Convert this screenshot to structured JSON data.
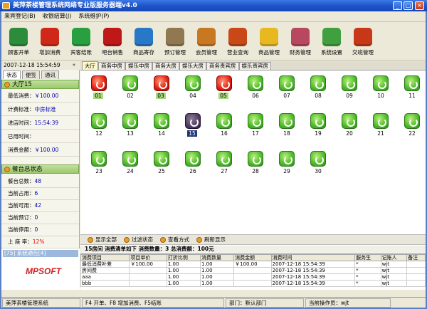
{
  "window": {
    "title": "美萍茶楼管理系统网络专业版服务器端v4.0",
    "min": "_",
    "max": "□",
    "close": "×"
  },
  "menu": [
    "来宾登记(B)",
    "收银结算(J)",
    "系统维护(P)"
  ],
  "toolbar": [
    {
      "label": "顾客开单",
      "icon": "teacup-icon",
      "color": "#2c8c3c"
    },
    {
      "label": "增加消费",
      "icon": "plus-icon",
      "color": "#d02818"
    },
    {
      "label": "宾客结账",
      "icon": "checkout-arrow-icon",
      "color": "#28a040"
    },
    {
      "label": "吧台销售",
      "icon": "wine-icon",
      "color": "#c01818"
    },
    {
      "label": "商品寄存",
      "icon": "basket-icon",
      "color": "#2878c8"
    },
    {
      "label": "预订管理",
      "icon": "clock-icon",
      "color": "#907850"
    },
    {
      "label": "会员管理",
      "icon": "members-icon",
      "color": "#c87820"
    },
    {
      "label": "营业查询",
      "icon": "search-pen-icon",
      "color": "#c84818"
    },
    {
      "label": "商品管理",
      "icon": "star-icon",
      "color": "#e8b820"
    },
    {
      "label": "财务管理",
      "icon": "calculator-icon",
      "color": "#b84860"
    },
    {
      "label": "系统设置",
      "icon": "gears-icon",
      "color": "#40a040"
    },
    {
      "label": "交班管理",
      "icon": "exit-door-icon",
      "color": "#c83818"
    }
  ],
  "left": {
    "datetime": "2007-12-18 15:54:59",
    "collapse": "«",
    "tabs": [
      "状态",
      "便签",
      "通讯"
    ],
    "room_section_title": "大厅15",
    "room_info": [
      {
        "label": "最低消费：",
        "value": "￥100.00"
      },
      {
        "label": "计费标准：",
        "value": "中房标准"
      },
      {
        "label": "进店时间：",
        "value": "15:54:39"
      },
      {
        "label": "已用时间：",
        "value": ""
      },
      {
        "label": "消费金额：",
        "value": "￥100.00"
      }
    ],
    "summary_title": "餐台总状态",
    "summary": [
      {
        "label": "餐台总数：",
        "value": "48"
      },
      {
        "label": "当前占用：",
        "value": "6"
      },
      {
        "label": "当前可用：",
        "value": "42"
      },
      {
        "label": "当前预订：",
        "value": "0"
      },
      {
        "label": "当前停用：",
        "value": "0"
      },
      {
        "label": "上 座 率：",
        "value": "12%"
      }
    ],
    "sys_notice": "[75] 系统通告[4]",
    "logo_text": "MPSOFT"
  },
  "area_tabs": [
    "大厅",
    "商务中房",
    "娱乐中房",
    "商务大房",
    "娱乐大房",
    "商务贵宾房",
    "娱乐贵宾房"
  ],
  "rooms": [
    {
      "num": "01",
      "state": "occupied"
    },
    {
      "num": "02",
      "state": "free"
    },
    {
      "num": "03",
      "state": "occupied"
    },
    {
      "num": "04",
      "state": "free"
    },
    {
      "num": "05",
      "state": "occupied"
    },
    {
      "num": "06",
      "state": "free"
    },
    {
      "num": "07",
      "state": "free"
    },
    {
      "num": "08",
      "state": "free"
    },
    {
      "num": "09",
      "state": "free"
    },
    {
      "num": "10",
      "state": "free"
    },
    {
      "num": "11",
      "state": "free"
    },
    {
      "num": "12",
      "state": "free"
    },
    {
      "num": "13",
      "state": "free"
    },
    {
      "num": "14",
      "state": "free"
    },
    {
      "num": "15",
      "state": "selected"
    },
    {
      "num": "16",
      "state": "free"
    },
    {
      "num": "17",
      "state": "free"
    },
    {
      "num": "18",
      "state": "free"
    },
    {
      "num": "19",
      "state": "free"
    },
    {
      "num": "20",
      "state": "free"
    },
    {
      "num": "21",
      "state": "free"
    },
    {
      "num": "22",
      "state": "free"
    },
    {
      "num": "23",
      "state": "free"
    },
    {
      "num": "24",
      "state": "free"
    },
    {
      "num": "25",
      "state": "free"
    },
    {
      "num": "26",
      "state": "free"
    },
    {
      "num": "27",
      "state": "free"
    },
    {
      "num": "28",
      "state": "free"
    },
    {
      "num": "29",
      "state": "free"
    },
    {
      "num": "30",
      "state": "free"
    }
  ],
  "actions": [
    "显示全部",
    "过滤状态",
    "查看方式",
    "刷新显示"
  ],
  "consumption_header": "15房间  消费清单如下 消费数量：3 总消费额：100元",
  "table": {
    "headers": [
      "消费项目",
      "项目单价",
      "打折比例",
      "消费数量",
      "消费金额",
      "消费时间",
      "服务生",
      "记账人",
      "备注"
    ],
    "rows": [
      [
        "最低消费补差",
        "￥100.00",
        "1.00",
        "1.00",
        "￥100.00",
        "2007-12-18 15:54:39",
        "*",
        "wjt",
        ""
      ],
      [
        "房间费",
        "",
        "1.00",
        "1.00",
        "",
        "2007-12-18 15:54:39",
        "*",
        "wjt",
        ""
      ],
      [
        "aaa",
        "",
        "1.00",
        "1.00",
        "",
        "2007-12-18 15:54:39",
        "*",
        "wjt",
        ""
      ],
      [
        "bbb",
        "",
        "1.00",
        "1.00",
        "",
        "2007-12-18 15:54:39",
        "*",
        "wjt",
        ""
      ]
    ]
  },
  "status": [
    "美萍茶楼管理系统",
    "F4 开单、F8 增加消费、F5结账",
    "部门：默认部门",
    "当前操作员：wjt"
  ]
}
